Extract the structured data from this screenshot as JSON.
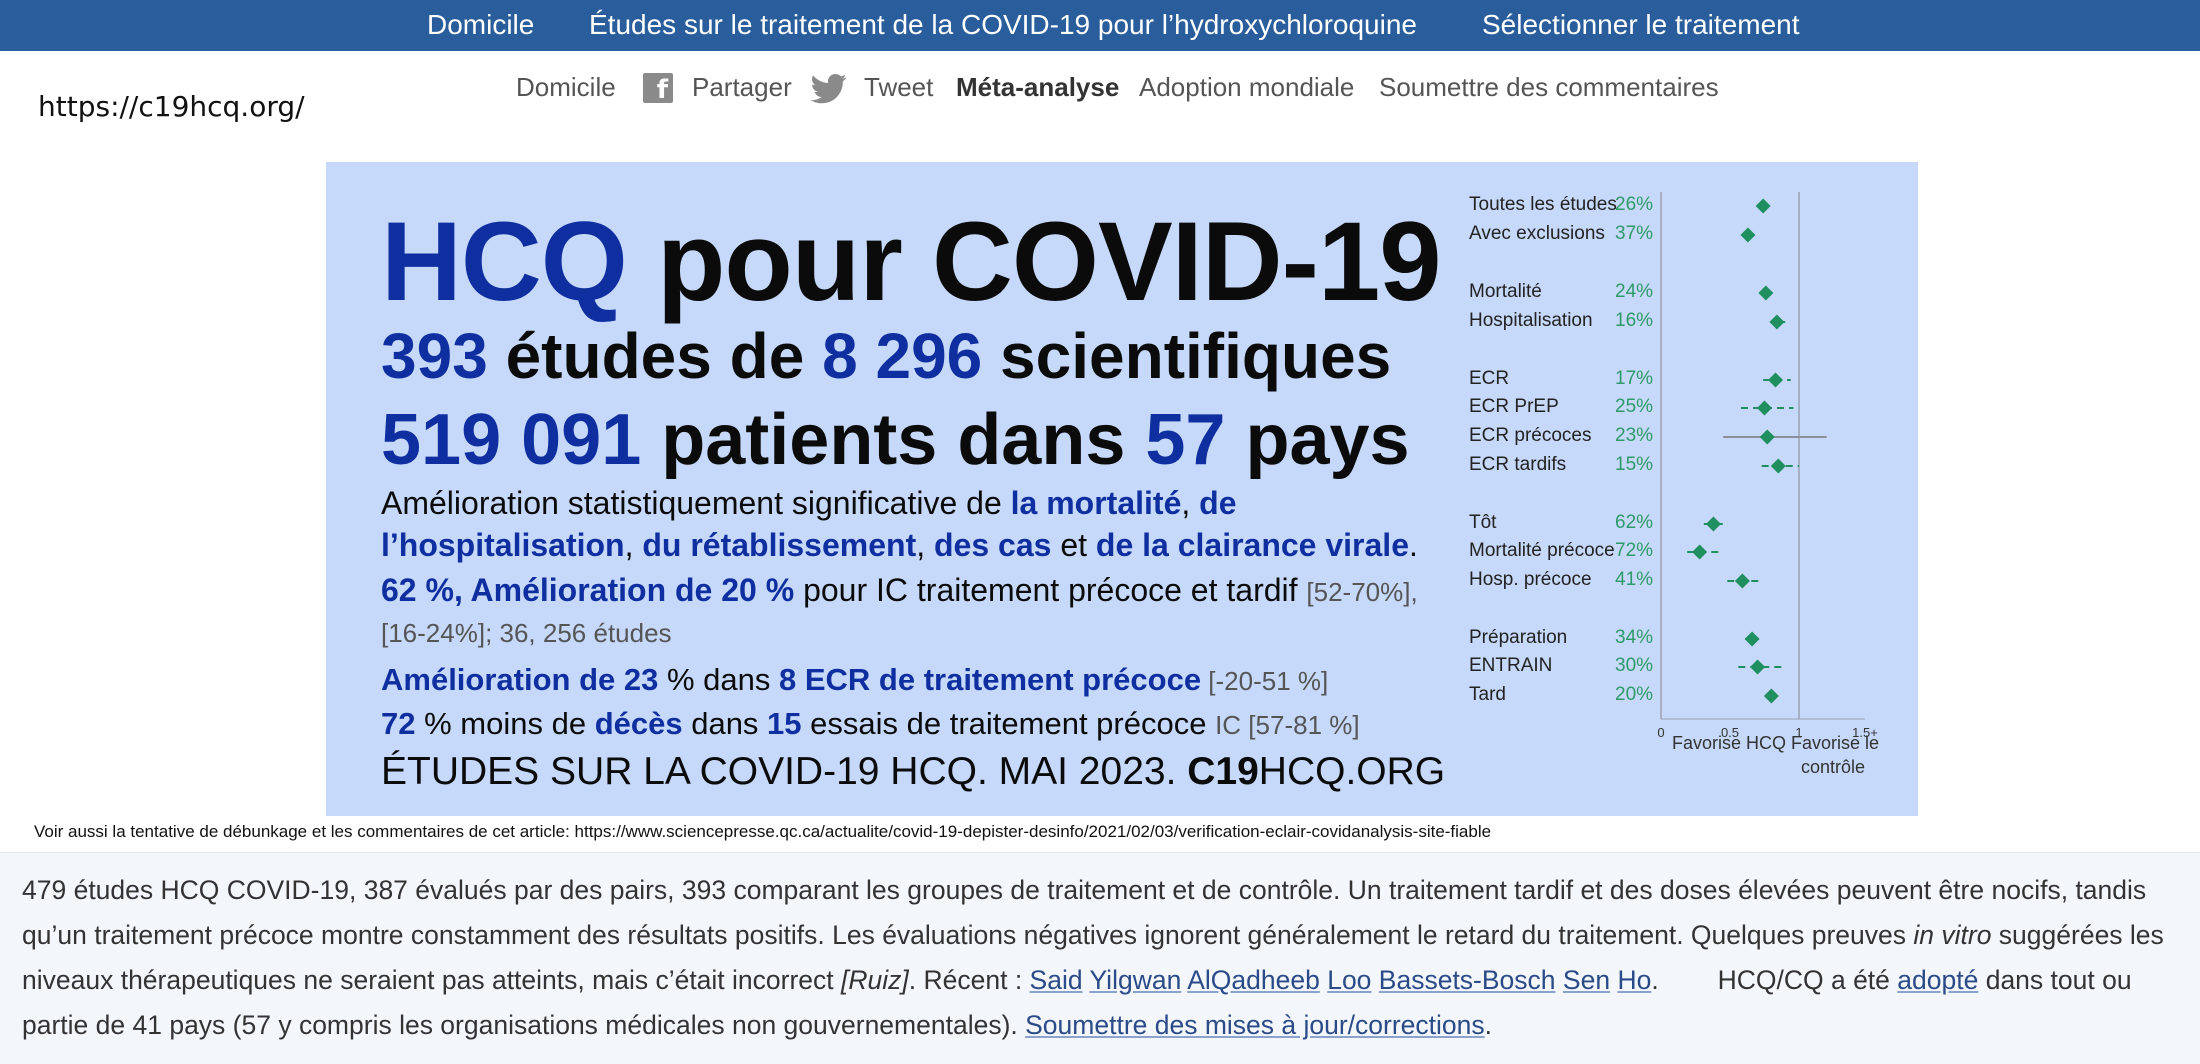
{
  "topnav": {
    "home": "Domicile",
    "studies": "Études sur le traitement de la COVID-19 pour l’hydroxychloroquine",
    "select": "Sélectionner le traitement"
  },
  "url_label": "https://c19hcq.org/",
  "subnav": {
    "home": "Domicile",
    "share": "Partager",
    "tweet": "Tweet",
    "meta": "Méta-analyse",
    "adoption": "Adoption mondiale",
    "feedback": "Soumettre des commentaires"
  },
  "banner": {
    "title_hcq": "HCQ",
    "title_rest": " pour COVID-19",
    "l1_n1": "393",
    "l1_t1": " études de ",
    "l1_n2": "8 296",
    "l1_t2": " scientifiques",
    "l2_n1": "519 091",
    "l2_t1": " patients dans ",
    "l2_n2": "57",
    "l2_t2": " pays",
    "p1_t1": "Amélioration statistiquement significative de ",
    "p1_b1": "la mortalité",
    "p1_s1": ", ",
    "p1_b2": "de",
    "p2_b1": "l’hospitalisation",
    "p2_s1": ", ",
    "p2_b2": "du rétablissement",
    "p2_s2": ", ",
    "p2_b3": "des cas",
    "p2_t1": " et ",
    "p2_b4": "de la clairance virale",
    "p2_t2": ".",
    "p3_b1": "62 %, Amélioration de 20 %",
    "p3_t1": " pour IC traitement précoce et tardif ",
    "p3_g1": "[52-70%],",
    "p4": "[16-24%]; 36, 256 études",
    "p5_b1": "Amélioration de 23",
    "p5_t1": " % dans ",
    "p5_b2": "8 ECR de traitement précoce",
    "p5_g1": " [-20-51 %]",
    "p6_b1": "72",
    "p6_t1": " % moins de ",
    "p6_b2": "décès",
    "p6_t2": " dans ",
    "p6_b3": "15",
    "p6_t3": " essais de traitement précoce ",
    "p6_g1": "IC [57-81 %]",
    "p7_t1": "ÉTUDES SUR LA COVID-19 HCQ. MAI 2023. ",
    "p7_b1": "C19",
    "p7_t2": "HCQ.ORG"
  },
  "forest": {
    "rows": [
      {
        "label": "Toutes les études",
        "pct": "26%",
        "value": 0.74,
        "lo": 0.74,
        "hi": 0.74
      },
      {
        "label": "Avec exclusions",
        "pct": "37%",
        "value": 0.63,
        "lo": 0.63,
        "hi": 0.63
      },
      {
        "label": "Mortalité",
        "pct": "24%",
        "value": 0.76,
        "lo": 0.76,
        "hi": 0.76
      },
      {
        "label": "Hospitalisation",
        "pct": "16%",
        "value": 0.84,
        "lo": 0.8,
        "hi": 0.9
      },
      {
        "label": "ECR",
        "pct": "17%",
        "value": 0.83,
        "lo": 0.74,
        "hi": 0.94
      },
      {
        "label": "ECR PrEP",
        "pct": "25%",
        "value": 0.75,
        "lo": 0.58,
        "hi": 0.96
      },
      {
        "label": "ECR précoces",
        "pct": "23%",
        "value": 0.77,
        "lo": 0.45,
        "hi": 1.2
      },
      {
        "label": "ECR tardifs",
        "pct": "15%",
        "value": 0.85,
        "lo": 0.73,
        "hi": 1.0
      },
      {
        "label": "Tôt",
        "pct": "62%",
        "value": 0.38,
        "lo": 0.31,
        "hi": 0.46
      },
      {
        "label": "Mortalité précoce",
        "pct": "72%",
        "value": 0.28,
        "lo": 0.19,
        "hi": 0.43
      },
      {
        "label": "Hosp. précoce",
        "pct": "41%",
        "value": 0.59,
        "lo": 0.48,
        "hi": 0.71
      },
      {
        "label": "Préparation",
        "pct": "34%",
        "value": 0.66,
        "lo": 0.61,
        "hi": 0.71
      },
      {
        "label": "ENTRAIN",
        "pct": "30%",
        "value": 0.7,
        "lo": 0.56,
        "hi": 0.88
      },
      {
        "label": "Tard",
        "pct": "20%",
        "value": 0.8,
        "lo": 0.76,
        "hi": 0.84
      }
    ],
    "ticks": [
      "0",
      "0.5",
      "1",
      "1.5+"
    ],
    "favors_hcq": "Favorise HCQ",
    "favors_control_1": "Favorise le",
    "favors_control_2": "contrôle",
    "color": "#1f8f5f"
  },
  "footnote": "Voir aussi la tentative de débunkage et les commentaires de cet article: https://www.sciencepresse.qc.ca/actualite/covid-19-depister-desinfo/2021/02/03/verification-eclair-covidanalysis-site-fiable",
  "description": {
    "t1": "479 études HCQ COVID-19, 387 évalués par des pairs, 393 comparant les groupes de traitement et de contrôle. Un traitement tardif et des doses élevées peuvent être nocifs, tandis qu’un traitement précoce montre constamment des résultats positifs. Les évaluations négatives ignorent généralement le retard du traitement. Quelques preuves ",
    "i1": "in vitro",
    "t2": " suggérées les niveaux thérapeutiques ne seraient pas atteints, mais c’était incorrect ",
    "i2": "[Ruiz]",
    "t3": ". Récent : ",
    "links": [
      "Said",
      "Yilgwan",
      "AlQadheeb",
      "Loo",
      "Bassets-Bosch",
      "Sen",
      "Ho"
    ],
    "t4": ".        HCQ/CQ a été ",
    "adopted": "adopté",
    "t5": " dans tout ou partie de 41 pays (57 y compris les organisations médicales non gouvernementales). ",
    "submit": "Soumettre des mises à jour/corrections",
    "t6": "."
  }
}
